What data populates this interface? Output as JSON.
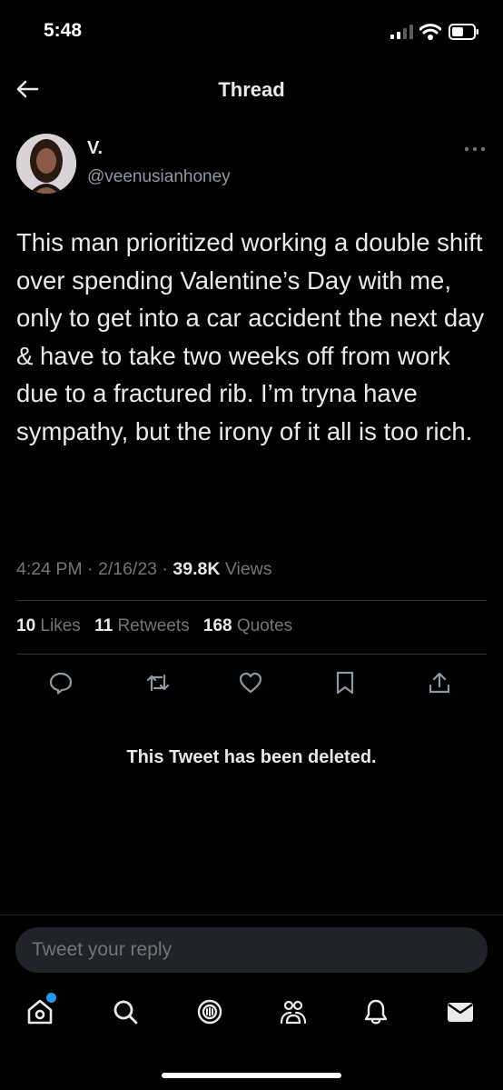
{
  "status_bar": {
    "time": "5:48"
  },
  "header": {
    "title": "Thread",
    "back_icon": "arrow-left-icon"
  },
  "tweet": {
    "name": "V.",
    "handle": "@veenusianhoney",
    "text": "This man prioritized working a double shift over spending Valentine’s Day with me, only to get into a car accident the next day & have to take two weeks off from work due to a fractured rib. I’m tryna have sympathy, but the irony of it all is too rich.",
    "time": "4:24 PM",
    "date": "2/16/23",
    "views_count": "39.8K",
    "views_label": "Views",
    "likes_count": "10",
    "likes_label": "Likes",
    "retweets_count": "11",
    "retweets_label": "Retweets",
    "quotes_count": "168",
    "quotes_label": "Quotes",
    "separator": "·"
  },
  "actions": [
    "reply-icon",
    "retweet-icon",
    "like-icon",
    "bookmark-icon",
    "share-icon"
  ],
  "deleted_notice": "This Tweet has been deleted.",
  "reply": {
    "placeholder": "Tweet your reply"
  },
  "tabbar": [
    "home-icon",
    "search-icon",
    "spaces-icon",
    "communities-icon",
    "notifications-icon",
    "messages-icon"
  ],
  "colors": {
    "accent": "#1d9bf0",
    "background": "#000000",
    "muted": "#71767b"
  }
}
